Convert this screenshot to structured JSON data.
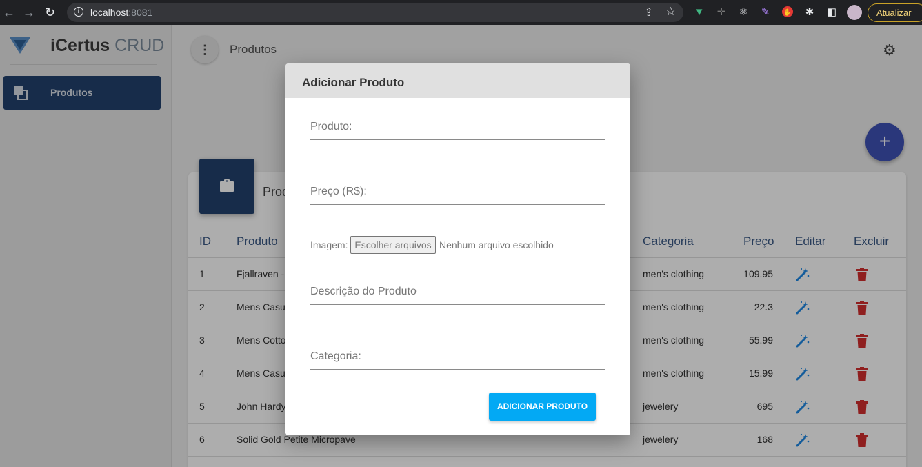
{
  "browser": {
    "host": "localhost",
    "port": ":8081",
    "update_label": "Atualizar"
  },
  "sidebar": {
    "brand_bold": "iCertus",
    "brand_light": "CRUD",
    "items": [
      {
        "label": "Produtos"
      }
    ]
  },
  "header": {
    "breadcrumb": "Produtos"
  },
  "fab": {
    "label": "+"
  },
  "card": {
    "title": "Prod"
  },
  "table": {
    "columns": [
      "ID",
      "Produto",
      "Categoria",
      "Preço",
      "Editar",
      "Excluir"
    ],
    "rows": [
      {
        "id": "1",
        "produto": "Fjallraven - I",
        "categoria": "men's clothing",
        "preco": "109.95"
      },
      {
        "id": "2",
        "produto": "Mens Casua",
        "categoria": "men's clothing",
        "preco": "22.3"
      },
      {
        "id": "3",
        "produto": "Mens Cotto",
        "categoria": "men's clothing",
        "preco": "55.99"
      },
      {
        "id": "4",
        "produto": "Mens Casua",
        "categoria": "men's clothing",
        "preco": "15.99"
      },
      {
        "id": "5",
        "produto": "John Hardy",
        "categoria": "jewelery",
        "preco": "695"
      },
      {
        "id": "6",
        "produto": "Solid Gold Petite Micropave",
        "categoria": "jewelery",
        "preco": "168"
      }
    ]
  },
  "dialog": {
    "title": "Adicionar Produto",
    "produto_placeholder": "Produto:",
    "preco_placeholder": "Preço (R$):",
    "imagem_label": "Imagem:",
    "file_button": "Escolher arquivos",
    "file_none": "Nenhum arquivo escolhido",
    "descricao_placeholder": "Descrição do Produto",
    "categoria_placeholder": "Categoria:",
    "submit_label": "ADICIONAR PRODUTO"
  },
  "colors": {
    "primary": "#23426e",
    "fab": "#3f51b5",
    "submit": "#03a9f4",
    "delete": "#d32f2f",
    "edit": "#1e88e5"
  }
}
